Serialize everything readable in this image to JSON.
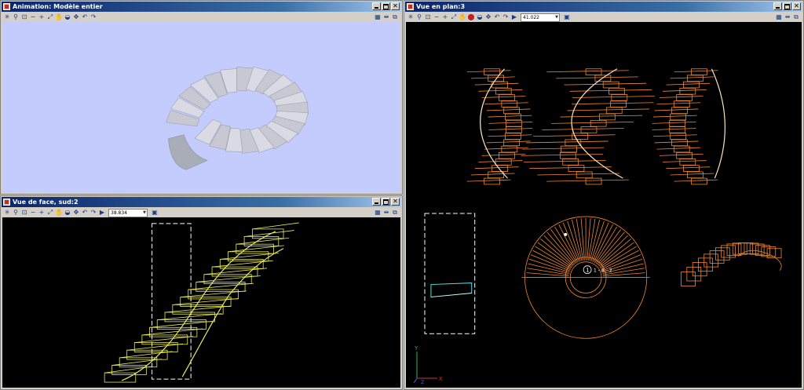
{
  "windows": {
    "animation": {
      "title": "Animation: Modèle entier"
    },
    "front": {
      "title": "Vue de face, sud:2",
      "zoom": "38.834"
    },
    "plan": {
      "title": "Vue en plan:3",
      "zoom": "41.022"
    }
  },
  "plan_view": {
    "callout_label": "1 - A - 2",
    "axis_x": "X",
    "axis_y": "Y",
    "axis_z": "Z"
  },
  "icons": {
    "toolbar": [
      "asterisk-icon",
      "zoom-icon",
      "zoom-window-icon",
      "zoom-out-icon",
      "zoom-in-icon",
      "fit-icon",
      "pan-icon",
      "shade-icon",
      "navigate-icon",
      "undo-view-icon",
      "redo-view-icon",
      "view-props-icon"
    ],
    "right": [
      "tile-icon",
      "sync-icon",
      "copy-icon"
    ]
  },
  "colors": {
    "model_bg": "#c3ccfc",
    "cad_bg": "#000000",
    "front_wire": "#e8e85a",
    "plan_wire": "#f08a32",
    "accent_cyan": "#4de0ea"
  }
}
